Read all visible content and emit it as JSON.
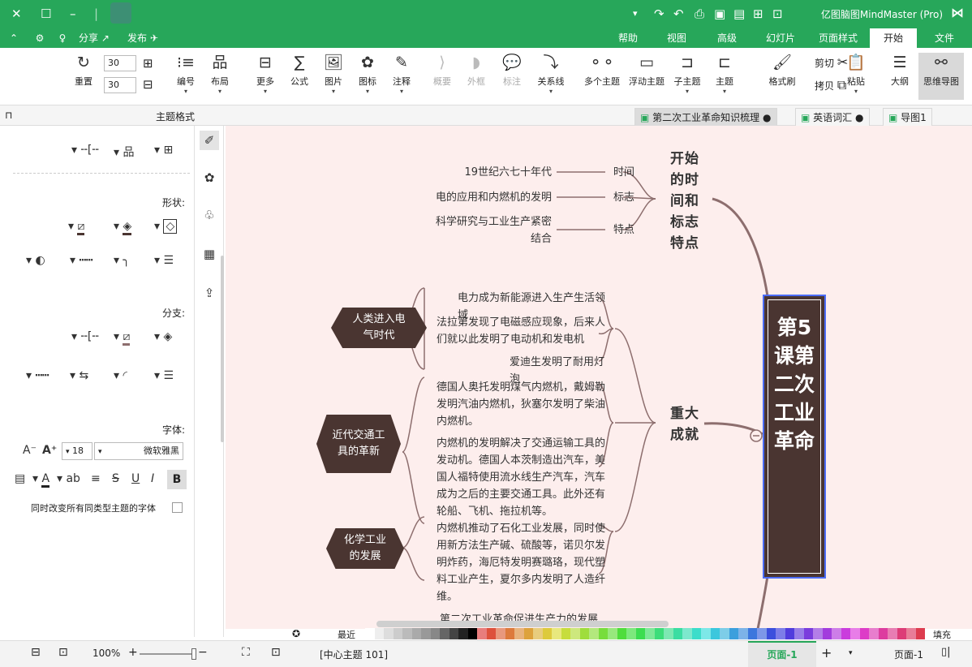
{
  "app": {
    "title": "亿图脑图MindMaster (Pro)"
  },
  "menu": {
    "tabs": [
      "文件",
      "开始",
      "页面样式",
      "幻灯片",
      "高级",
      "视图",
      "帮助"
    ],
    "publish": "发布",
    "share": "分享"
  },
  "ribbon": {
    "buttons": [
      "思维导图",
      "大纲",
      "粘贴",
      "剪切",
      "拷贝",
      "格式刷",
      "主题",
      "子主题",
      "浮动主题",
      "多个主题",
      "关系线",
      "标注",
      "外框",
      "概要",
      "注释",
      "图标",
      "图片",
      "公式",
      "更多",
      "布局",
      "编号",
      "重置"
    ],
    "spin1": "30",
    "spin2": "30"
  },
  "doc_tabs": [
    "导图1",
    "英语词汇",
    "第二次工业革命知识梳理"
  ],
  "panel": {
    "title": "主题格式",
    "shape": "形状:",
    "branch": "分支:",
    "font": "字体:",
    "font_name": "微软雅黑",
    "font_size": "18",
    "bold": "B",
    "italic": "I",
    "underline": "U",
    "strike": "S",
    "apply_label": "同时改变所有同类型主题的字体"
  },
  "map": {
    "center": "第5课第二次工业革命",
    "topic1": "开始的时间和标志特点",
    "t1_labels": [
      "时间",
      "标志",
      "特点"
    ],
    "t1_texts": [
      "19世纪六七十年代",
      "电的应用和内燃机的发明",
      "科学研究与工业生产紧密结合"
    ],
    "topic2": "重大成就",
    "subs": [
      "人类进入电气时代",
      "近代交通工具的革新",
      "化学工业的发展"
    ],
    "details": [
      "电力成为新能源进入生产生活领域",
      "法拉第发现了电磁感应现象，后来人们就以此发明了电动机和发电机",
      "爱迪生发明了耐用灯泡",
      "德国人奥托发明煤气内燃机，戴姆勒发明汽油内燃机，狄塞尔发明了柴油内燃机。",
      "内燃机的发明解决了交通运输工具的发动机。德国人本茨制造出汽车，美国人福特使用流水线生产汽车，汽车成为之后的主要交通工具。此外还有轮船、飞机、拖拉机等。",
      "内燃机推动了石化工业发展，同时使用新方法生产碱、硫酸等，诺贝尔发明炸药，海厄特发明赛璐珞，现代塑料工业产生，夏尔多内发明了人造纤维。"
    ],
    "cut_text": "第二次工业革命促进生产力的发展"
  },
  "colors": {
    "accent": "#27a75a",
    "node": "#4a3531",
    "canvas": "#fdeeed",
    "line": "#8d6e6e",
    "select": "#4b6cf7"
  },
  "palette": {
    "recent": "最近",
    "fill": "填充"
  },
  "status": {
    "page_tab": "页面-1",
    "page_label": "页面-1",
    "topic_info": "[中心主题 101]",
    "zoom": "100%"
  }
}
